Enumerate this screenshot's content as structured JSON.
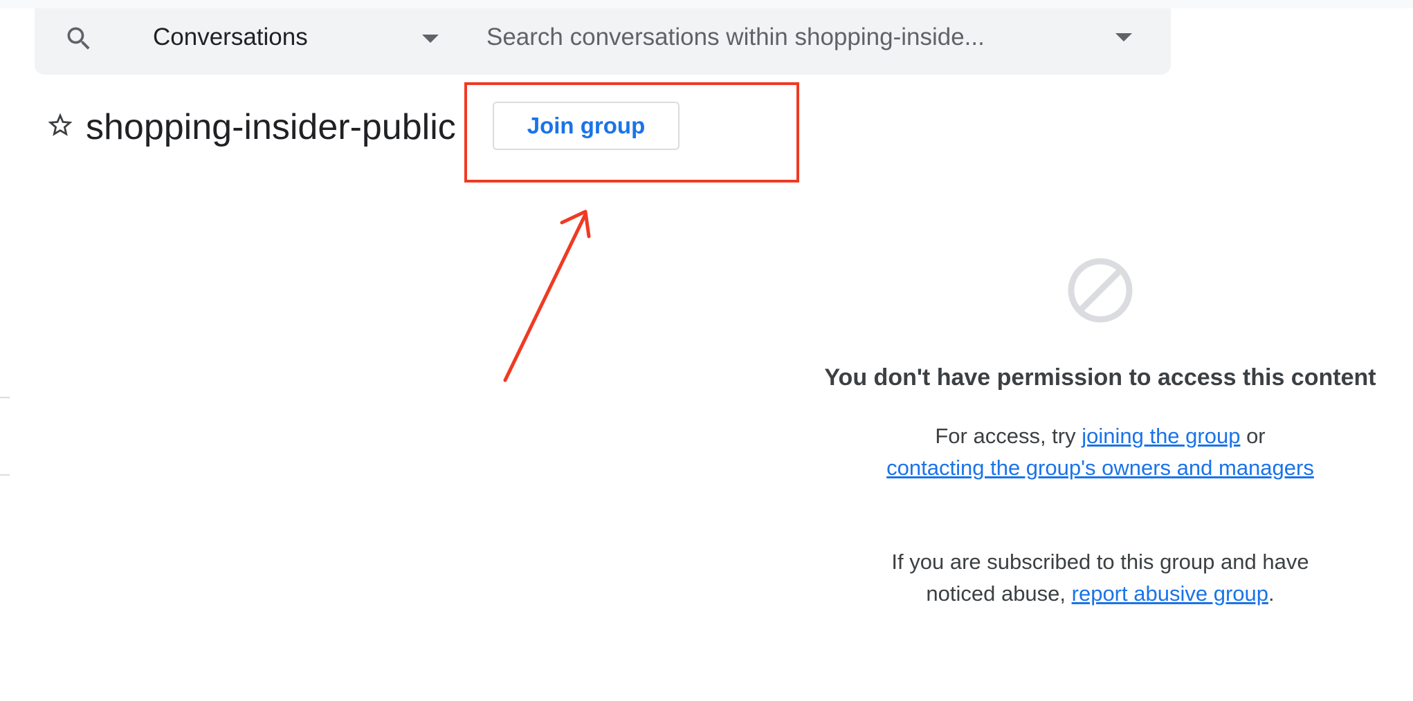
{
  "search": {
    "scope_label": "Conversations",
    "placeholder": "Search conversations within shopping-inside..."
  },
  "group": {
    "title": "shopping-insider-public",
    "join_label": "Join group"
  },
  "empty_state": {
    "title": "You don't have permission to access this content",
    "access_prefix": "For access, try ",
    "join_link": "joining the group",
    "access_middle": " or",
    "contact_link": "contacting the group's owners and managers",
    "abuse_prefix": "If you are subscribed to this group and have noticed abuse, ",
    "abuse_link": "report abusive group",
    "abuse_suffix": "."
  },
  "colors": {
    "link": "#1a73e8",
    "annotation": "#f03a22",
    "search_bg": "#f1f3f4"
  },
  "icons": [
    "search-icon",
    "chevron-down-icon",
    "star-outline-icon",
    "block-icon",
    "arrow-icon"
  ]
}
